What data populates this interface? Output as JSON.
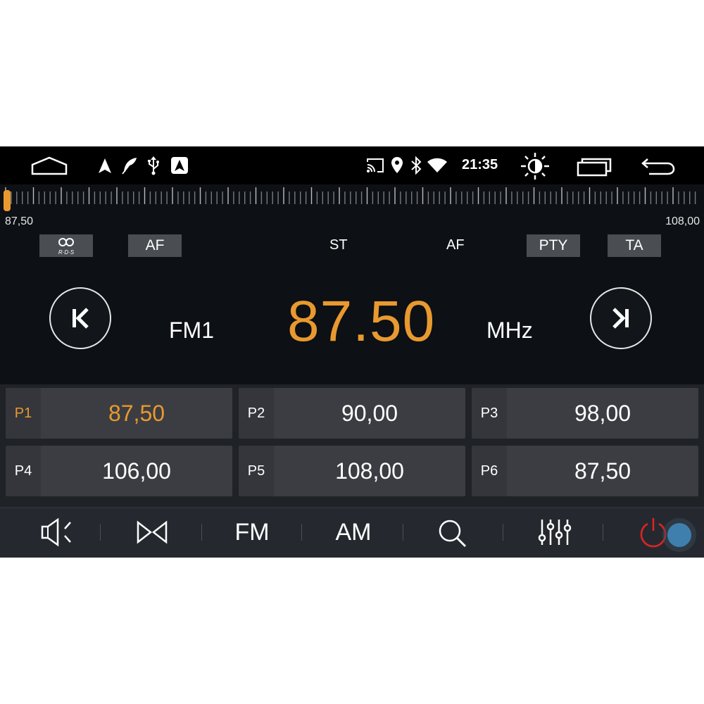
{
  "status_bar": {
    "clock": "21:35",
    "left_icons": [
      "home-icon",
      "navigation-arrow-icon",
      "feather-icon",
      "usb-icon",
      "android-auto-icon"
    ],
    "right_icons": [
      "cast-icon",
      "location-pin-icon",
      "bluetooth-icon",
      "wifi-icon",
      "brightness-icon",
      "recent-apps-icon",
      "back-icon"
    ]
  },
  "tuner": {
    "scale_min": "87,50",
    "scale_max": "108,00",
    "position": 0.0
  },
  "rds_row": {
    "rds_button": "R·D·S",
    "af_button": "AF",
    "st_indicator": "ST",
    "af_indicator": "AF",
    "pty_button": "PTY",
    "ta_button": "TA"
  },
  "main": {
    "band": "FM1",
    "frequency": "87.50",
    "unit": "MHz"
  },
  "presets": [
    {
      "tag": "P1",
      "freq": "87,50",
      "active": true
    },
    {
      "tag": "P2",
      "freq": "90,00",
      "active": false
    },
    {
      "tag": "P3",
      "freq": "98,00",
      "active": false
    },
    {
      "tag": "P4",
      "freq": "106,00",
      "active": false
    },
    {
      "tag": "P5",
      "freq": "108,00",
      "active": false
    },
    {
      "tag": "P6",
      "freq": "87,50",
      "active": false
    }
  ],
  "toolbar": {
    "fm_label": "FM",
    "am_label": "AM",
    "icons": [
      "speaker-icon",
      "stereo-icon",
      "search-icon",
      "equalizer-icon",
      "power-icon"
    ]
  },
  "colors": {
    "accent": "#e8992f",
    "background": "#0d1014",
    "power": "#e02424"
  }
}
